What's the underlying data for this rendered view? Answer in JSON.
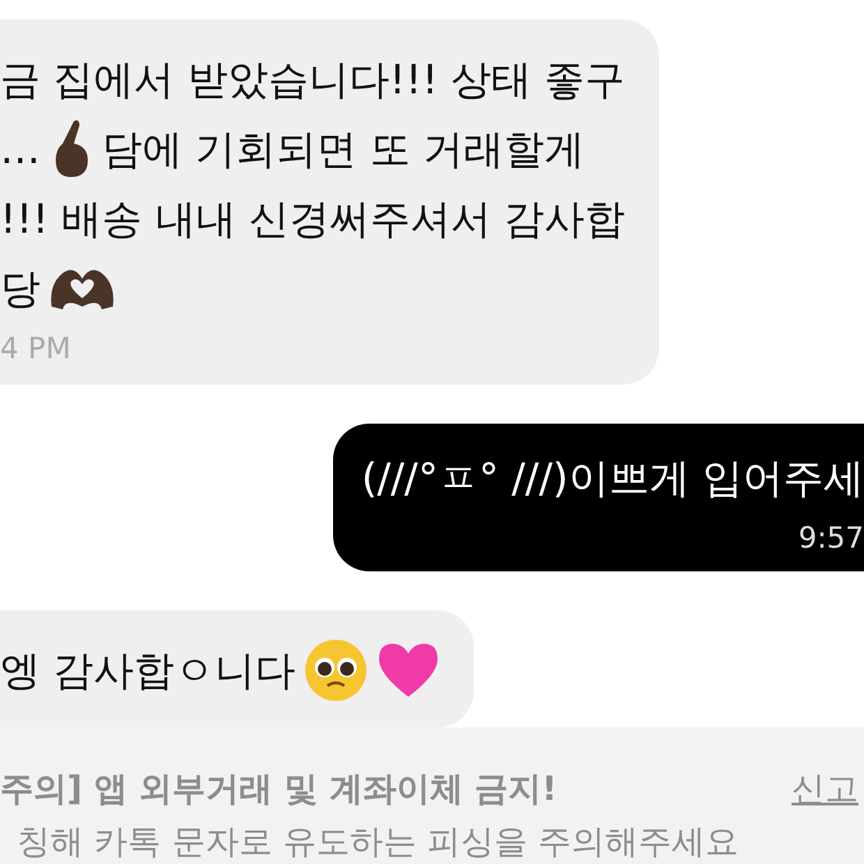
{
  "messages": [
    {
      "kind": "received",
      "lines": [
        [
          {
            "kind": "text",
            "text": "금 집에서 받았습니다!!! 상태 좋구"
          }
        ],
        [
          {
            "kind": "text",
            "text": "…"
          },
          {
            "kind": "finger-heart"
          },
          {
            "kind": "text",
            "text": "담에 기회되면 또 거래할게"
          }
        ],
        [
          {
            "kind": "text",
            "text": "!!! 배송 내내 신경써주셔서 감사합"
          }
        ],
        [
          {
            "kind": "text",
            "text": "당"
          },
          {
            "kind": "hand-heart"
          }
        ]
      ],
      "time": "4 PM"
    },
    {
      "kind": "sent",
      "lines": [
        [
          {
            "kind": "text",
            "text": "(///°ㅍ° ///)이쁘게 입어주세"
          }
        ]
      ],
      "time": "9:57"
    },
    {
      "kind": "received",
      "lines": [
        [
          {
            "kind": "text",
            "text": "엥 감사합ㅇ니다"
          },
          {
            "kind": "pleading-face"
          },
          {
            "kind": "pink-heart"
          }
        ]
      ]
    }
  ],
  "notice": {
    "title": "주의] 앱 외부거래 및 계좌이체 금지!",
    "link": "신고",
    "body": "칭해 카톡 문자로 유도하는 피싱을 주의해주세요"
  }
}
